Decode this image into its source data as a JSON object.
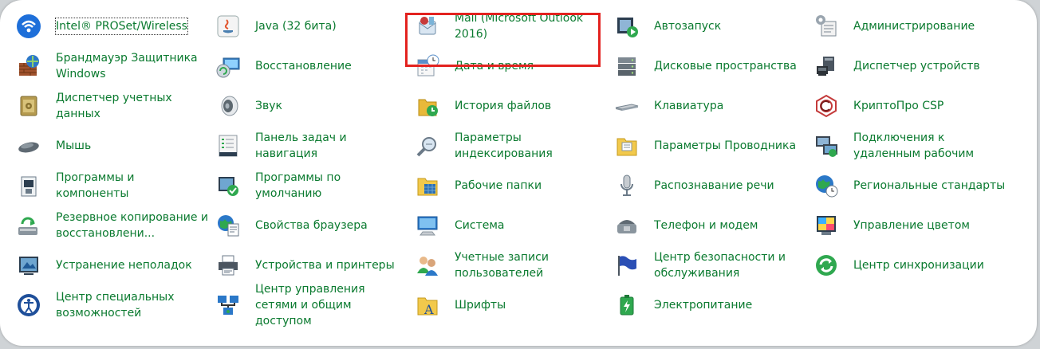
{
  "items": [
    {
      "label": "Intel® PROSet/Wireless",
      "icon": "wifi-icon"
    },
    {
      "label": "Java (32 бита)",
      "icon": "java-icon"
    },
    {
      "label": "Mail (Microsoft Outlook 2016)",
      "icon": "mail-icon"
    },
    {
      "label": "Автозапуск",
      "icon": "autoplay-icon"
    },
    {
      "label": "Администрирование",
      "icon": "admin-tools-icon"
    },
    {
      "label": "Брандмауэр Защитника Windows",
      "icon": "firewall-icon"
    },
    {
      "label": "Восстановление",
      "icon": "recovery-icon"
    },
    {
      "label": "Дата и время",
      "icon": "calendar-clock-icon"
    },
    {
      "label": "Дисковые пространства",
      "icon": "storage-spaces-icon"
    },
    {
      "label": "Диспетчер устройств",
      "icon": "device-manager-icon"
    },
    {
      "label": "Диспетчер учетных данных",
      "icon": "credential-safe-icon"
    },
    {
      "label": "Звук",
      "icon": "speaker-icon"
    },
    {
      "label": "История файлов",
      "icon": "file-history-icon"
    },
    {
      "label": "Клавиатура",
      "icon": "keyboard-icon"
    },
    {
      "label": "КриптоПро CSP",
      "icon": "cryptopro-icon"
    },
    {
      "label": "Мышь",
      "icon": "mouse-icon"
    },
    {
      "label": "Панель задач и навигация",
      "icon": "taskbar-icon"
    },
    {
      "label": "Параметры индексирования",
      "icon": "indexing-icon"
    },
    {
      "label": "Параметры Проводника",
      "icon": "explorer-options-icon"
    },
    {
      "label": "Подключения к удаленным рабочим",
      "icon": "remote-desktop-icon"
    },
    {
      "label": "Программы и компоненты",
      "icon": "programs-icon"
    },
    {
      "label": "Программы по умолчанию",
      "icon": "default-programs-icon"
    },
    {
      "label": "Рабочие папки",
      "icon": "work-folders-icon"
    },
    {
      "label": "Распознавание речи",
      "icon": "microphone-icon"
    },
    {
      "label": "Региональные стандарты",
      "icon": "globe-clock-icon"
    },
    {
      "label": "Резервное копирование и восстановлени...",
      "icon": "backup-icon"
    },
    {
      "label": "Свойства браузера",
      "icon": "internet-options-icon"
    },
    {
      "label": "Система",
      "icon": "system-icon"
    },
    {
      "label": "Телефон и модем",
      "icon": "phone-modem-icon"
    },
    {
      "label": "Управление цветом",
      "icon": "color-management-icon"
    },
    {
      "label": "Устранение неполадок",
      "icon": "troubleshoot-icon"
    },
    {
      "label": "Устройства и принтеры",
      "icon": "printer-icon"
    },
    {
      "label": "Учетные записи пользователей",
      "icon": "users-icon"
    },
    {
      "label": "Центр безопасности и обслуживания",
      "icon": "flag-icon"
    },
    {
      "label": "Центр синхронизации",
      "icon": "sync-icon"
    },
    {
      "label": "Центр специальных возможностей",
      "icon": "accessibility-icon"
    },
    {
      "label": "Центр управления сетями и общим доступом",
      "icon": "network-center-icon"
    },
    {
      "label": "Шрифты",
      "icon": "fonts-icon"
    },
    {
      "label": "Электропитание",
      "icon": "power-options-icon"
    }
  ],
  "colors": {
    "link": "#0a7a2f",
    "highlight": "#e3221f"
  }
}
